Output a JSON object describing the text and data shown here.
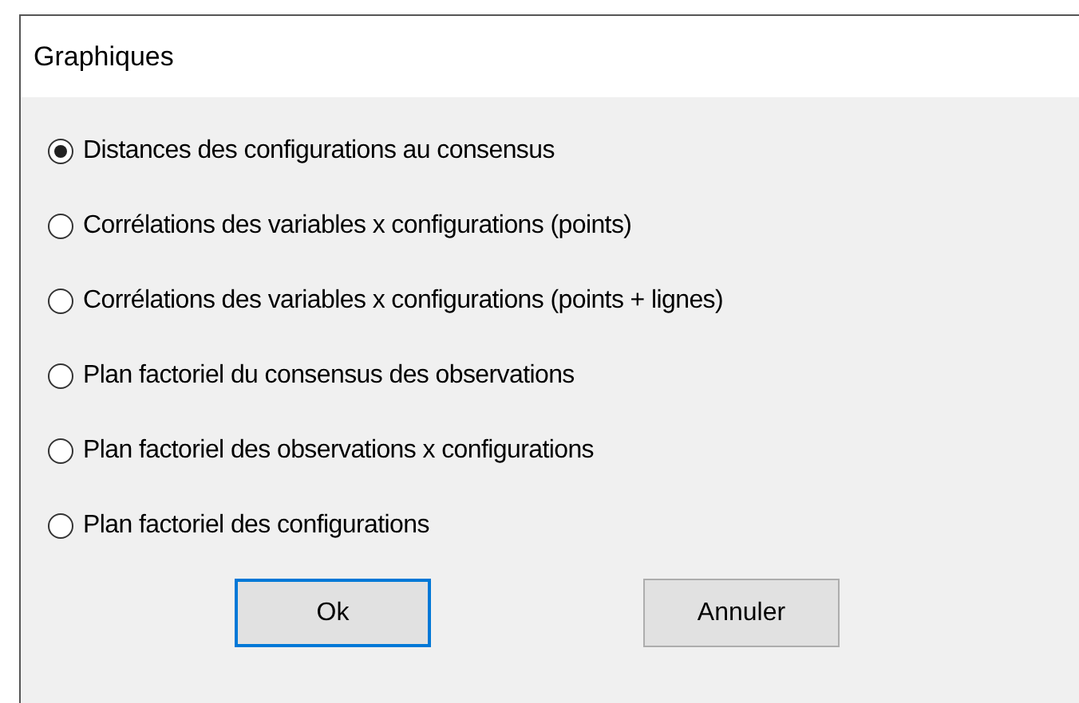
{
  "window": {
    "title": "Graphiques"
  },
  "options": [
    {
      "label": "Distances des configurations au consensus",
      "selected": true
    },
    {
      "label": "Corrélations des variables x configurations (points)",
      "selected": false
    },
    {
      "label": "Corrélations des variables x configurations (points + lignes)",
      "selected": false
    },
    {
      "label": "Plan factoriel du consensus des observations",
      "selected": false
    },
    {
      "label": "Plan factoriel des observations x configurations",
      "selected": false
    },
    {
      "label": "Plan factoriel des configurations",
      "selected": false
    }
  ],
  "buttons": [
    {
      "label": "Ok",
      "default": true
    },
    {
      "label": "Annuler",
      "default": false
    }
  ]
}
